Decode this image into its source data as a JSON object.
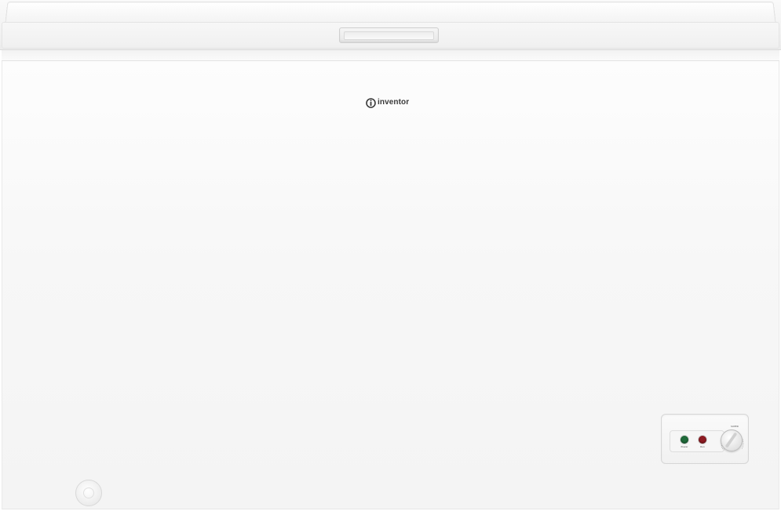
{
  "brand": {
    "logo_text": "inventor",
    "icon": "inventor-logo-icon",
    "color": "#3a3a3a"
  },
  "control_panel": {
    "indicators": [
      {
        "label": "Power",
        "color": "#1f6b3a"
      },
      {
        "label": "Run",
        "color": "#8e1b22"
      }
    ],
    "knob_label": "SUPER"
  },
  "colors": {
    "body": "#f7f7f7",
    "lid": "#f1f1f1"
  }
}
